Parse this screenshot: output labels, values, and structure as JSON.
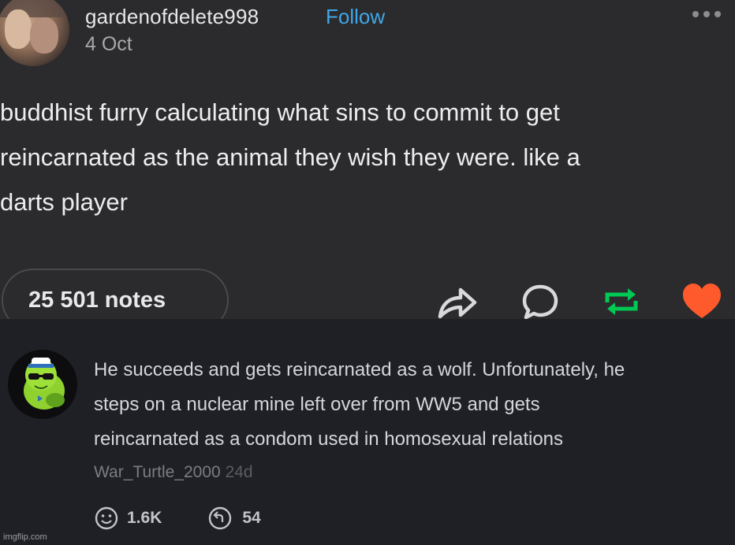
{
  "post": {
    "username": "gardenofdelete998",
    "follow_label": "Follow",
    "date": "4 Oct",
    "menu_icon": "more-dots-icon",
    "text_lines": [
      "buddhist furry calculating what sins to commit to get",
      "reincarnated as the animal they wish they were. like a",
      "darts player"
    ],
    "notes": "25 501 notes",
    "actions": [
      "share-icon",
      "reply-icon",
      "reblog-icon",
      "like-icon"
    ],
    "colors": {
      "follow": "#3fa8e8",
      "reblog": "#00c853",
      "like": "#ff5a2c"
    }
  },
  "comment": {
    "text_lines": [
      "He succeeds and gets reincarnated as a wolf. Unfortunately, he",
      "steps on a nuclear mine left over from WW5 and gets",
      "reincarnated as a condom used in homosexual relations"
    ],
    "author": "War_Turtle_2000",
    "time": "24d",
    "upvotes": "1.6K",
    "replies": "54"
  },
  "watermark": "imgflip.com"
}
